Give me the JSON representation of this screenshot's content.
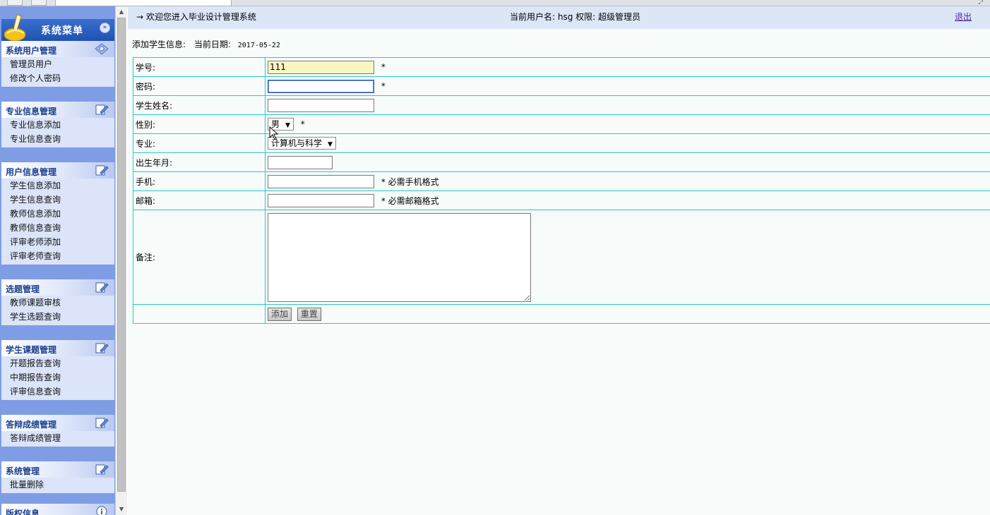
{
  "sidebar": {
    "menu_title": "系统菜单",
    "groups": [
      {
        "title": "系统用户管理",
        "items": [
          "管理员用户",
          "修改个人密码"
        ]
      },
      {
        "title": "专业信息管理",
        "items": [
          "专业信息添加",
          "专业信息查询"
        ]
      },
      {
        "title": "用户信息管理",
        "items": [
          "学生信息添加",
          "学生信息查询",
          "教师信息添加",
          "教师信息查询",
          "评审老师添加",
          "评审老师查询"
        ]
      },
      {
        "title": "选题管理",
        "items": [
          "教师课题审核",
          "学生选题查询"
        ]
      },
      {
        "title": "学生课题管理",
        "items": [
          "开题报告查询",
          "中期报告查询",
          "评审信息查询"
        ]
      },
      {
        "title": "答辩成绩管理",
        "items": [
          "答辩成绩管理"
        ]
      },
      {
        "title": "系统管理",
        "items": [
          "批量删除"
        ]
      },
      {
        "title": "版权信息",
        "items": []
      }
    ]
  },
  "topbar": {
    "welcome": "→ 欢迎您进入毕业设计管理系统",
    "user_info": "当前用户名: hsg 权限: 超级管理员",
    "logout": "退出"
  },
  "page": {
    "heading": "添加学生信息:",
    "date_label": "当前日期:",
    "date_value": "2017-05-22"
  },
  "form": {
    "student_id_label": "学号:",
    "student_id_value": "111",
    "password_label": "密码:",
    "password_value": "",
    "name_label": "学生姓名:",
    "name_value": "",
    "gender_label": "性别:",
    "gender_value": "男",
    "major_label": "专业:",
    "major_value": "计算机与科学",
    "birth_label": "出生年月:",
    "birth_value": "",
    "phone_label": "手机:",
    "phone_value": "",
    "phone_hint": "* 必需手机格式",
    "email_label": "邮箱:",
    "email_value": "",
    "email_hint": "* 必需邮箱格式",
    "notes_label": "备注:",
    "required_mark": "*",
    "submit_label": "添加",
    "reset_label": "重置"
  },
  "colors": {
    "sidebar_bg": "#7f9de4",
    "header_blue": "#1f51b0",
    "group_title_text": "#1a3f8e",
    "table_border": "#2bc6c9",
    "topbar_bg": "#dde6f6",
    "filled_input_bg": "#fdf6c3"
  },
  "icons": {
    "logo": "broom-icon",
    "collapse": "double-chevron-icon",
    "group_first": "diamond-gear-icon",
    "group_edit": "note-pencil-icon",
    "group_info": "info-icon"
  }
}
